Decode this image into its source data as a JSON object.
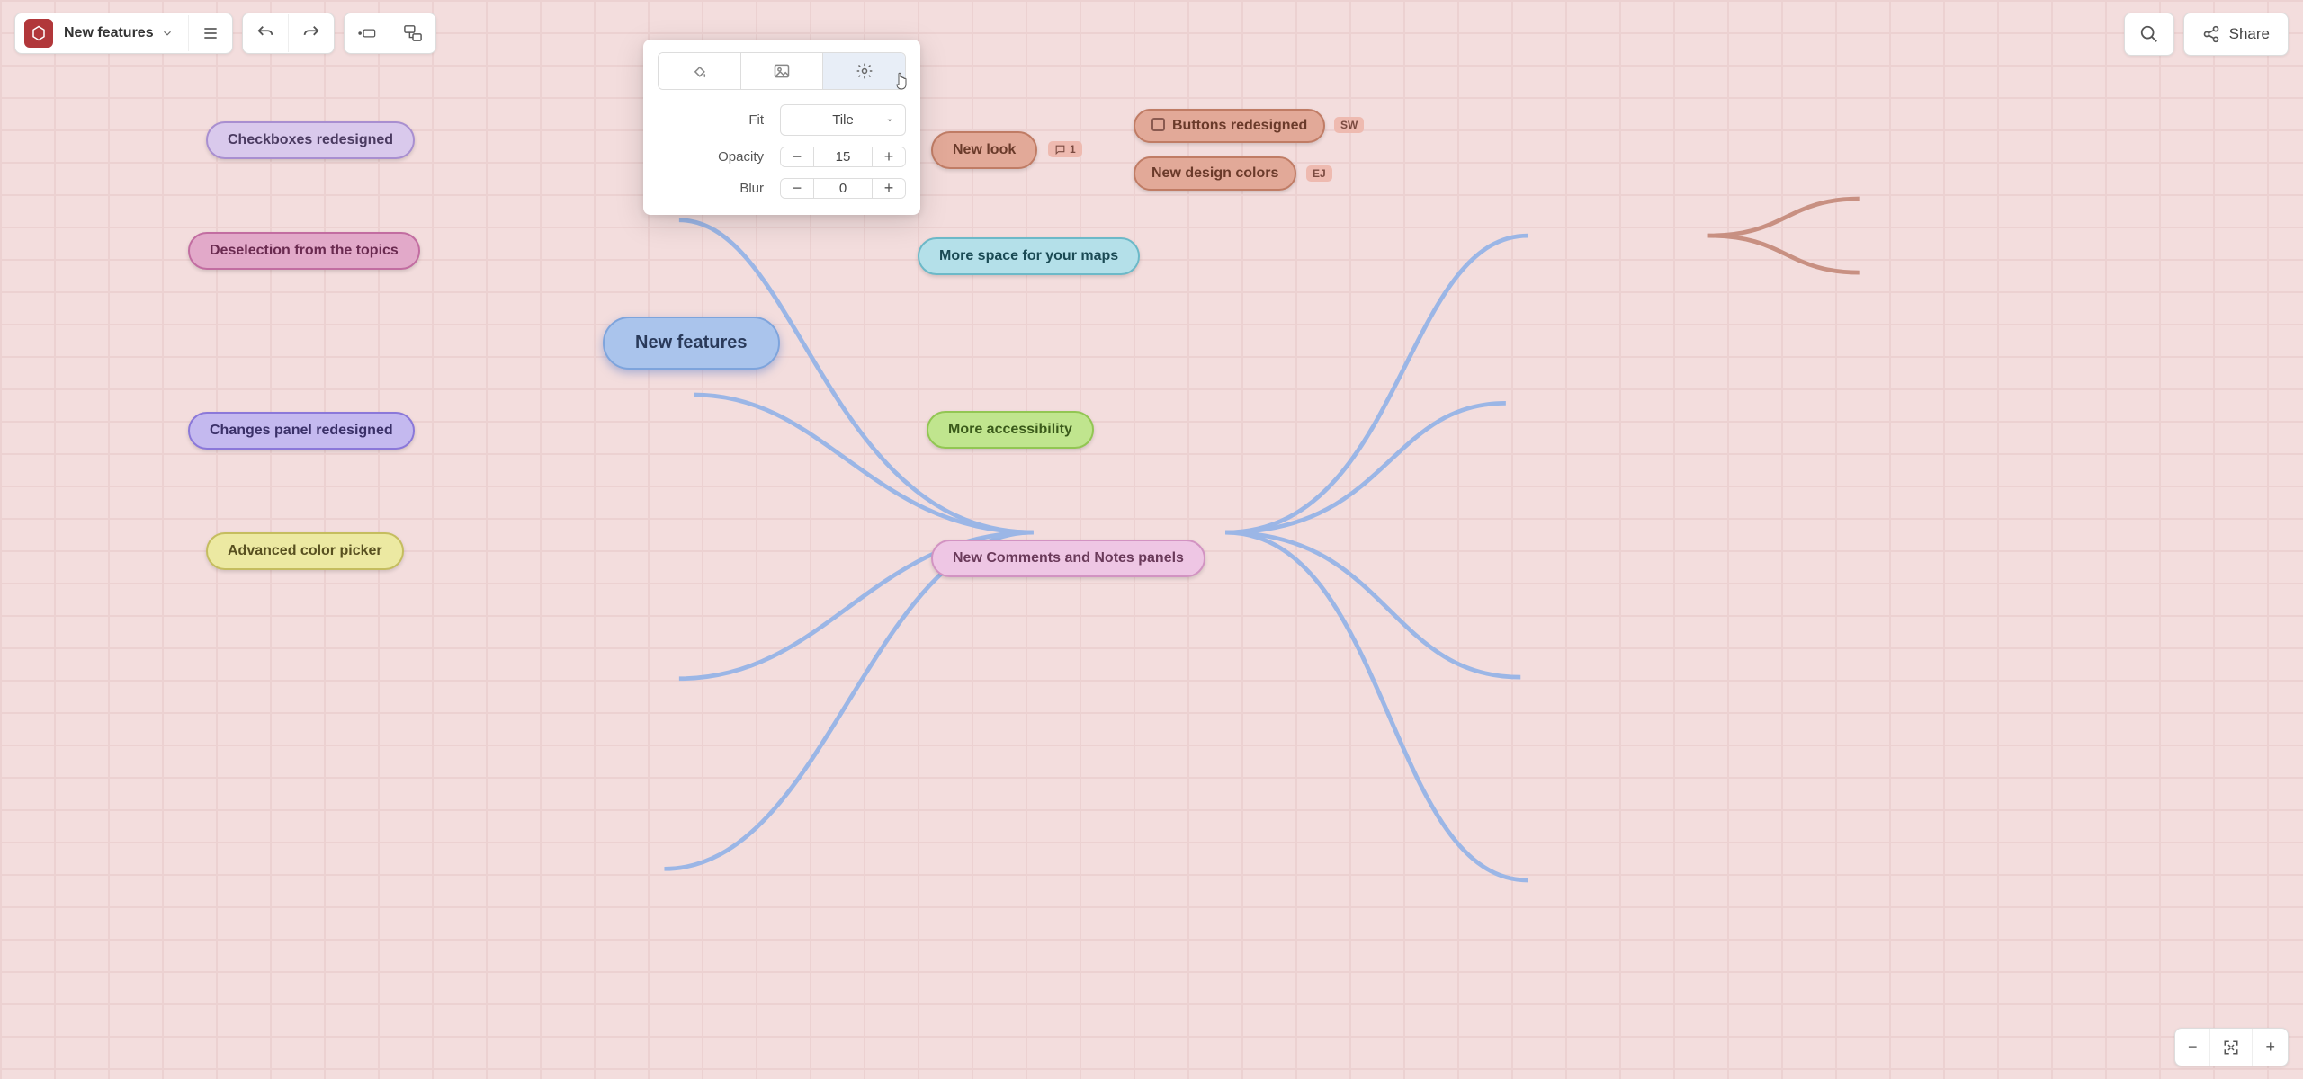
{
  "header": {
    "map_title": "New features",
    "share_label": "Share"
  },
  "popup": {
    "fit_label": "Fit",
    "fit_value": "Tile",
    "opacity_label": "Opacity",
    "opacity_value": "15",
    "blur_label": "Blur",
    "blur_value": "0"
  },
  "nodes": {
    "center": "New features",
    "left": [
      "Checkboxes redesigned",
      "Deselection from the topics",
      "Changes panel redesigned",
      "Advanced color picker"
    ],
    "right": [
      "New look",
      "More space for your maps",
      "More accessibility",
      "New Comments and Notes panels"
    ],
    "newlook_children": [
      "Buttons redesigned",
      "New design colors"
    ],
    "badges": {
      "comment_count": "1",
      "buttons_tag": "SW",
      "colors_tag": "EJ"
    }
  },
  "colors": {
    "center_fill": "#aac4ec",
    "center_border": "#7ea4dc",
    "lilac_fill": "#d9c9ec",
    "lilac_border": "#a98fd0",
    "pink_fill": "#e2a9c9",
    "pink_border": "#c26da1",
    "purple_fill": "#c4b9ef",
    "purple_border": "#8b78d9",
    "yellow_fill": "#ece9a2",
    "yellow_border": "#c5bd5f",
    "salmon_fill": "#e2a998",
    "salmon_border": "#c07c65",
    "teal_fill": "#b4e0e9",
    "teal_border": "#6cb9c8",
    "green_fill": "#c0e58e",
    "green_border": "#92c653",
    "rose_fill": "#eec6e4",
    "rose_border": "#d293c2",
    "badge_fill": "#eebab0",
    "badge_text": "#7a4a40"
  }
}
